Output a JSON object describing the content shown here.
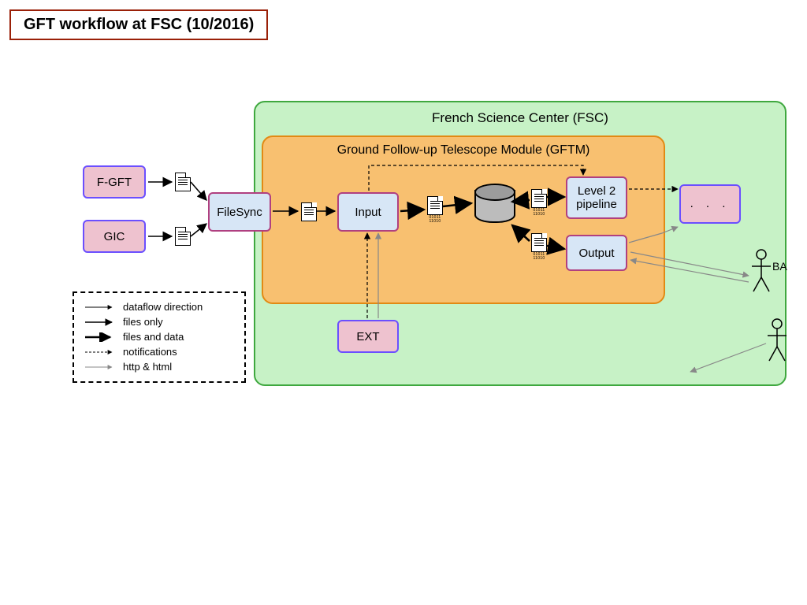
{
  "title": "GFT workflow at FSC (10/2016)",
  "containers": {
    "fsc": "French Science Center (FSC)",
    "gftm": "Ground Follow-up Telescope Module (GFTM)"
  },
  "nodes": {
    "fgft": "F-GFT",
    "gic": "GIC",
    "filesync": "FileSync",
    "input": "Input",
    "level2": "Level 2 pipeline",
    "output": "Output",
    "ext": "EXT",
    "ellipsis": ". . ."
  },
  "actors": {
    "ba": "BA"
  },
  "legend": {
    "dataflow": "dataflow direction",
    "files_only": "files only",
    "files_data": "files and data",
    "notifications": "notifications",
    "http_html": "http & html"
  }
}
